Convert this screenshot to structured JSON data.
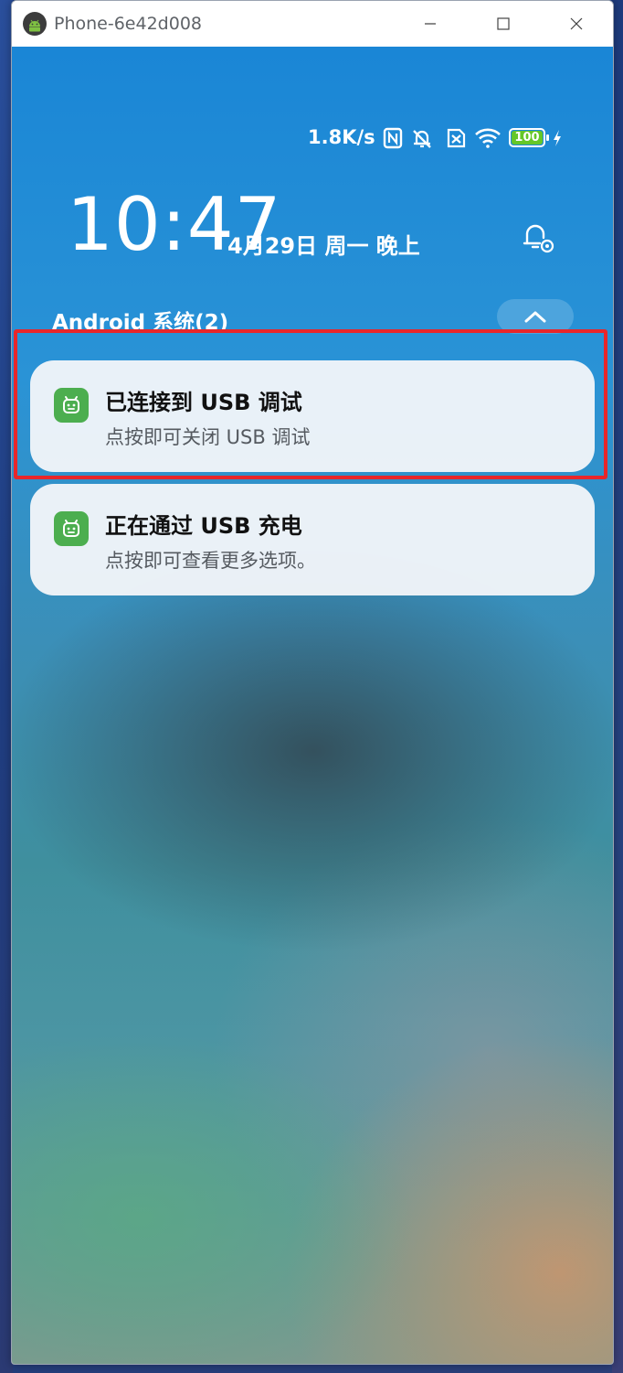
{
  "window": {
    "title": "Phone-6e42d008"
  },
  "status_bar": {
    "net_speed": "1.8K/s",
    "battery": "100",
    "icons": [
      "nfc-icon",
      "mute-icon",
      "sim-off-icon",
      "wifi-icon",
      "battery-icon",
      "charging-icon"
    ]
  },
  "lockscreen": {
    "time": "10:47",
    "date": "4月29日 周一 晚上"
  },
  "notifications": {
    "group_header": "Android 系统(2)",
    "items": [
      {
        "title": "已连接到 USB 调试",
        "text": "点按即可关闭 USB 调试"
      },
      {
        "title": "正在通过 USB 充电",
        "text": "点按即可查看更多选项。"
      }
    ]
  },
  "colors": {
    "highlight": "#e8262a",
    "app_icon_green": "#4cae4f"
  }
}
